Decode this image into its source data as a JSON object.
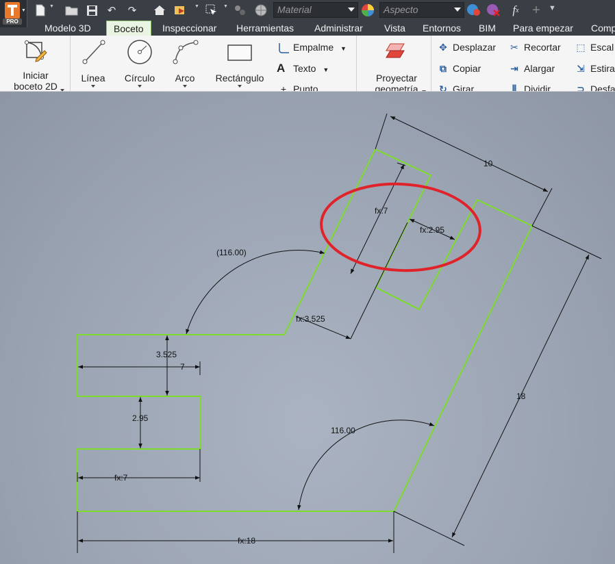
{
  "app": {
    "edition_badge": "PRO",
    "icons": [
      "new-icon",
      "open-icon",
      "save-icon",
      "undo-icon",
      "redo-icon",
      "home-icon",
      "update-icon",
      "select-icon",
      "appearance-icon",
      "color-icon",
      "clear-override-icon",
      "fx-icon",
      "plus-icon",
      "customize-icon"
    ]
  },
  "quick_access": {
    "material_placeholder": "Material",
    "appearance_placeholder": "Aspecto",
    "fx_label": "f",
    "fx_sub": "x"
  },
  "tabs": [
    {
      "label": "Modelo 3D"
    },
    {
      "label": "Boceto",
      "active": true
    },
    {
      "label": "Inspeccionar"
    },
    {
      "label": "Herramientas"
    },
    {
      "label": "Administrar"
    },
    {
      "label": "Vista"
    },
    {
      "label": "Entornos"
    },
    {
      "label": "BIM"
    },
    {
      "label": "Para empezar"
    },
    {
      "label": "Comp"
    }
  ],
  "ribbon": {
    "start_sketch": {
      "line1": "Iniciar",
      "line2": "boceto 2D"
    },
    "line": "Línea",
    "circle": "Círculo",
    "arc": "Arco",
    "rectangle": "Rectángulo",
    "fillet": "Empalme",
    "text": "Texto",
    "point": "Punto",
    "project": {
      "line1": "Proyectar",
      "line2": "geometría"
    },
    "move": "Desplazar",
    "copy": "Copiar",
    "rotate": "Girar",
    "trim": "Recortar",
    "extend": "Alargar",
    "split": "Dividir",
    "scale": "Escal",
    "stretch": "Estira",
    "offset": "Desfa"
  },
  "sketch": {
    "colors": {
      "profile": "#7ddc2a",
      "dimension": "#111111",
      "highlight": "#e0232a"
    },
    "dimensions": {
      "top_width": "10",
      "inner_length": "fx:7",
      "slot_width": "fx:2.95",
      "angle_top": "(116.00)",
      "offset_top": "fx:3.525",
      "left_height": "3.525",
      "left_depth": "7",
      "slot_height": "2.95",
      "bottom_depth": "fx:7",
      "right_length": "18",
      "angle_bottom": "116.00",
      "base_length": "fx:18"
    }
  }
}
